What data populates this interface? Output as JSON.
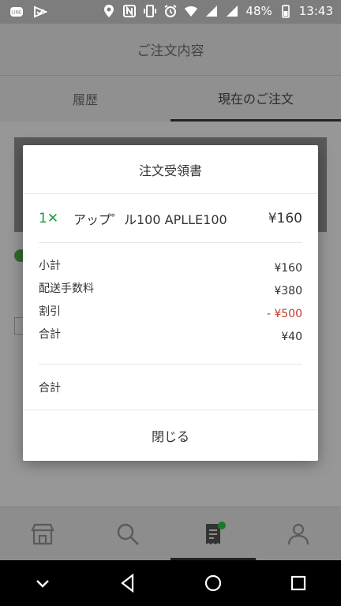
{
  "status_bar": {
    "battery": "48%",
    "time": "13:43"
  },
  "header": {
    "title": "ご注文内容"
  },
  "tabs": [
    {
      "label": "履歴"
    },
    {
      "label": "現在のご注文"
    }
  ],
  "modal": {
    "title": "注文受領書",
    "item": {
      "qty": "1✕",
      "name": "アップ゜ル100 APLLE100",
      "price": "¥160"
    },
    "summary": [
      {
        "label": "小計",
        "value": "¥160"
      },
      {
        "label": "配送手数料",
        "value": "¥380"
      },
      {
        "label": "割引",
        "value": "- ¥500"
      },
      {
        "label": "合計",
        "value": "¥40"
      }
    ],
    "total_label": "合計",
    "close_label": "閉じる"
  },
  "colors": {
    "discount": "#c0392b",
    "quantity": "#1a9a3a",
    "cart_badge": "#1a7a2c"
  },
  "bottom_nav": [
    "store-icon",
    "search-icon",
    "receipt-icon",
    "profile-icon"
  ]
}
